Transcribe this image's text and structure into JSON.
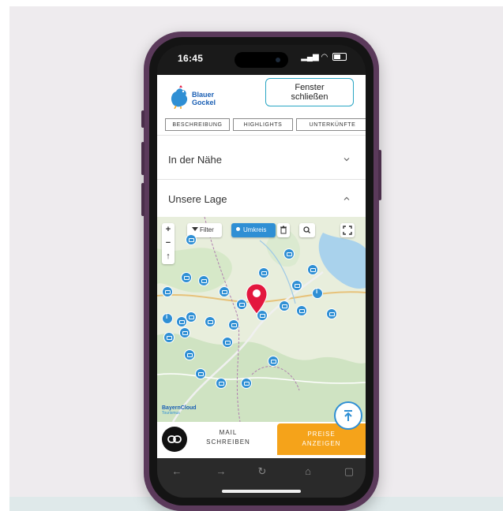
{
  "status_bar": {
    "time": "16:45"
  },
  "header": {
    "logo_line1": "Blauer",
    "logo_line2": "Gockel",
    "close_line1": "Fenster",
    "close_line2": "schließen"
  },
  "tabs": [
    {
      "label": "BESCHREIBUNG"
    },
    {
      "label": "HIGHLIGHTS"
    },
    {
      "label": "UNTERKÜNFTE"
    }
  ],
  "accordions": {
    "nearby": {
      "label": "In der Nähe",
      "expanded": false
    },
    "location": {
      "label": "Unsere Lage",
      "expanded": true
    }
  },
  "map": {
    "filter_label": "Filter",
    "radius_label": "Umkreis",
    "zoom_in": "+",
    "zoom_out": "−",
    "attribution_name": "BayernCloud",
    "attribution_sub": "Tourismus"
  },
  "bottom_bar": {
    "mail_line1": "MAIL",
    "mail_line2": "SCHREIBEN",
    "prices_line1": "PREISE",
    "prices_line2": "ANZEIGEN"
  },
  "colors": {
    "accent_blue": "#2f8fd4",
    "pin_red": "#e3173e",
    "cta_orange": "#f5a31a",
    "phone_frame": "#5b3a5b"
  }
}
